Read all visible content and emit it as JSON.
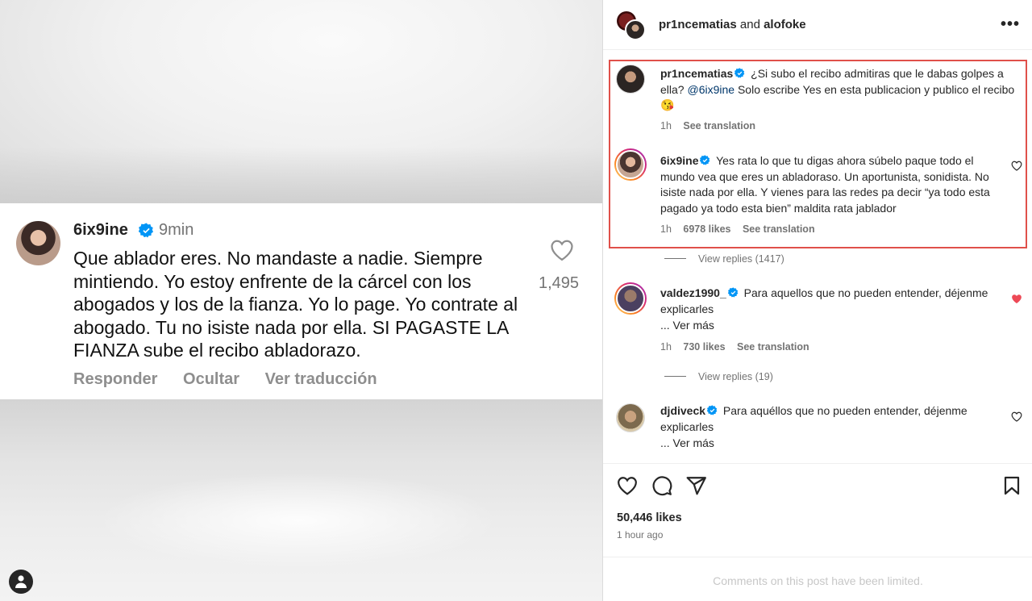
{
  "left_comment": {
    "username": "6ix9ine",
    "time": "9min",
    "text": "Que ablador eres. No mandaste a nadie. Siempre mintiendo. Yo estoy enfrente de la cárcel con los abogados y los de la fianza. Yo lo page. Yo contrate al abogado. Tu no isiste nada por ella. SI PAGASTE LA FIANZA sube el recibo abladorazo.",
    "likes": "1,495",
    "actions": [
      "Responder",
      "Ocultar",
      "Ver traducción"
    ]
  },
  "header": {
    "user1": "pr1ncematias",
    "and": "and",
    "user2": "alofoke",
    "more": "•••"
  },
  "comments": [
    {
      "username": "pr1ncematias",
      "text_a": "¿Si subo el recibo admitiras que le dabas golpes a ella?",
      "mention": "@6ix9ine",
      "text_b": "Solo escribe Yes en esta publicacion y publico el recibo 😘",
      "time": "1h",
      "translate": "See translation"
    },
    {
      "username": "6ix9ine",
      "text": "Yes rata lo que tu digas ahora súbelo paque todo el mundo vea que eres un abladoraso. Un aportunista, sonidista. No isiste nada por ella. Y vienes para las redes pa decir “ya todo esta pagado ya todo esta bien” maldita rata jablador",
      "time": "1h",
      "likes": "6978 likes",
      "translate": "See translation",
      "replies": "View replies (1417)"
    },
    {
      "username": "valdez1990_",
      "text": "Para aquellos que no pueden entender, déjenme explicarles",
      "more": "... Ver más",
      "time": "1h",
      "likes": "730 likes",
      "translate": "See translation",
      "replies": "View replies (19)"
    },
    {
      "username": "djdiveck",
      "text": "Para aquéllos que no pueden entender, déjenme explicarles",
      "more": "... Ver más"
    }
  ],
  "post": {
    "likes": "50,446 likes",
    "posted": "1 hour ago",
    "limited": "Comments on this post have been limited."
  },
  "colors": {
    "verified": "#0095f6",
    "liked": "#ed4956",
    "highlight": "#e0504a"
  }
}
